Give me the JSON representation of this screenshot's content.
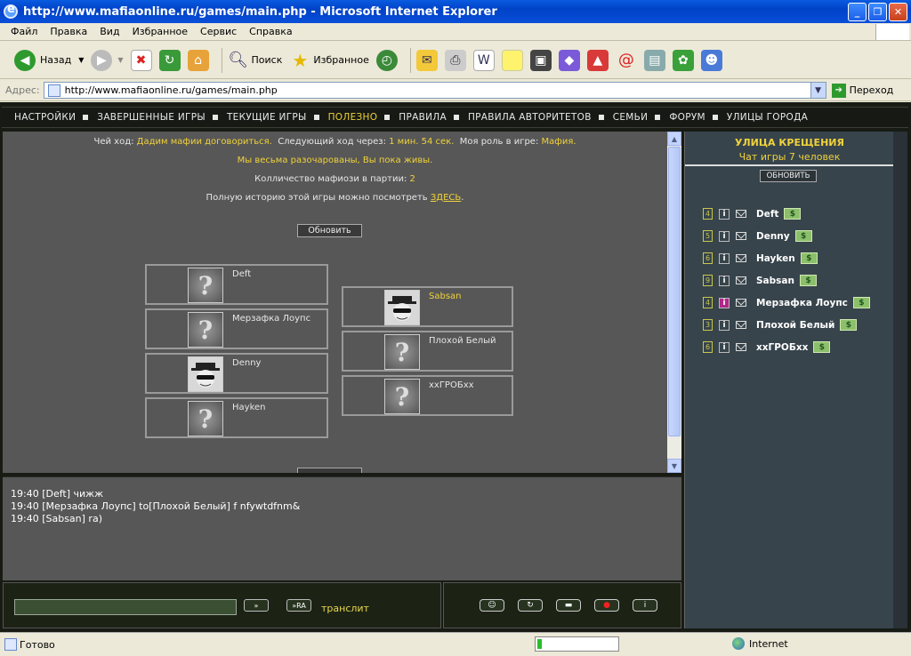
{
  "window": {
    "title": "http://www.mafiaonline.ru/games/main.php - Microsoft Internet Explorer"
  },
  "menu": [
    "Файл",
    "Правка",
    "Вид",
    "Избранное",
    "Сервис",
    "Справка"
  ],
  "toolbar": {
    "back": "Назад",
    "search": "Поиск",
    "favorites": "Избранное"
  },
  "address": {
    "label": "Адрес:",
    "url": "http://www.mafiaonline.ru/games/main.php",
    "go": "Переход"
  },
  "nav": [
    {
      "label": "НАСТРОЙКИ"
    },
    {
      "label": "ЗАВЕРШЕННЫЕ ИГРЫ"
    },
    {
      "label": "ТЕКУЩИЕ ИГРЫ"
    },
    {
      "label": "ПОЛЕЗНО",
      "active": true
    },
    {
      "label": "ПРАВИЛА"
    },
    {
      "label": "ПРАВИЛА АВТОРИТЕТОВ"
    },
    {
      "label": "СЕМЬИ"
    },
    {
      "label": "ФОРУМ"
    },
    {
      "label": "УЛИЦЫ ГОРОДА"
    }
  ],
  "game": {
    "turn_label": "Чей ход:",
    "turn_value": "Дадим мафии договориться.",
    "next_label": "Следующий ход через:",
    "next_value": "1 мин. 54 сек.",
    "role_label": "Моя роль в игре:",
    "role_value": "Мафия.",
    "status": "Мы весьма разочарованы, Вы пока живы.",
    "mafia_label": "Колличество мафиози в партии:",
    "mafia_count": "2",
    "history_text": "Полную историю этой игры можно посмотреть",
    "history_link": "ЗДЕСЬ",
    "history_end": ".",
    "refresh": "Обновить"
  },
  "players_left": [
    {
      "name": "Deft",
      "photo": "question"
    },
    {
      "name": "Мерзафка Лоупс",
      "photo": "question"
    },
    {
      "name": "Denny",
      "photo": "hat"
    },
    {
      "name": "Hayken",
      "photo": "question"
    }
  ],
  "players_right": [
    {
      "name": "Sabsan",
      "photo": "hat",
      "highlight": true
    },
    {
      "name": "Плохой Белый",
      "photo": "question"
    },
    {
      "name": "xxГРОБxx",
      "photo": "question"
    }
  ],
  "chat": [
    "19:40 [Deft] чижж",
    "19:40 [Мерзафка Лоупс] to[Плохой Белый] f nfywtdfnm&",
    "19:40 [Sabsan] ra)"
  ],
  "input": {
    "send": "»",
    "send_ru": "»RA",
    "translit": "транслит"
  },
  "sidebar": {
    "title": "УЛИЦА КРЕЩЕНИЯ",
    "subtitle": "Чат игры 7 человек",
    "refresh": "ОБНОВИТЬ",
    "users": [
      {
        "num": "4",
        "name": "Deft",
        "info_pink": false
      },
      {
        "num": "5",
        "name": "Denny",
        "info_pink": false
      },
      {
        "num": "6",
        "name": "Hayken",
        "info_pink": false
      },
      {
        "num": "9",
        "name": "Sabsan",
        "info_pink": false
      },
      {
        "num": "4",
        "name": "Мерзафка Лоупс",
        "info_pink": true
      },
      {
        "num": "3",
        "name": "Плохой Белый",
        "info_pink": false
      },
      {
        "num": "6",
        "name": "xxГРОБxx",
        "info_pink": false
      }
    ]
  },
  "status": {
    "ready": "Готово",
    "zone": "Internet",
    "progress": 0.06
  }
}
